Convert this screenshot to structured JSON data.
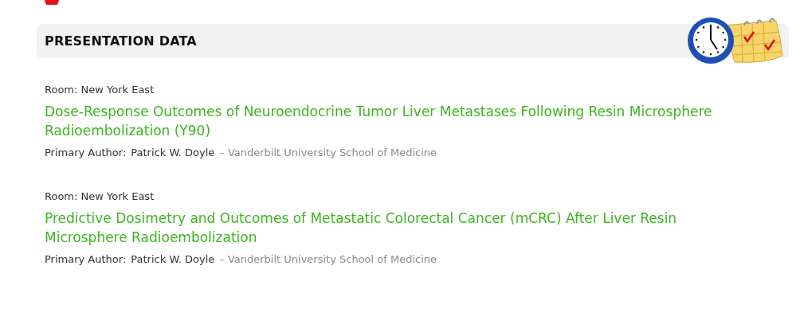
{
  "section": {
    "title": "PRESENTATION DATA"
  },
  "presentations": [
    {
      "room": "Room: New York East",
      "title": "Dose-Response Outcomes of Neuroendocrine Tumor Liver Metastases Following Resin Microsphere Radioembolization (Y90)",
      "author_label": "Primary Author:",
      "author": "Patrick W. Doyle",
      "affiliation": "– Vanderbilt University School of Medicine"
    },
    {
      "room": "Room: New York East",
      "title": "Predictive Dosimetry and Outcomes of Metastatic Colorectal Cancer (mCRC) After Liver Resin Microsphere Radioembolization",
      "author_label": "Primary Author:",
      "author": "Patrick W. Doyle",
      "affiliation": "– Vanderbilt University School of Medicine"
    }
  ]
}
